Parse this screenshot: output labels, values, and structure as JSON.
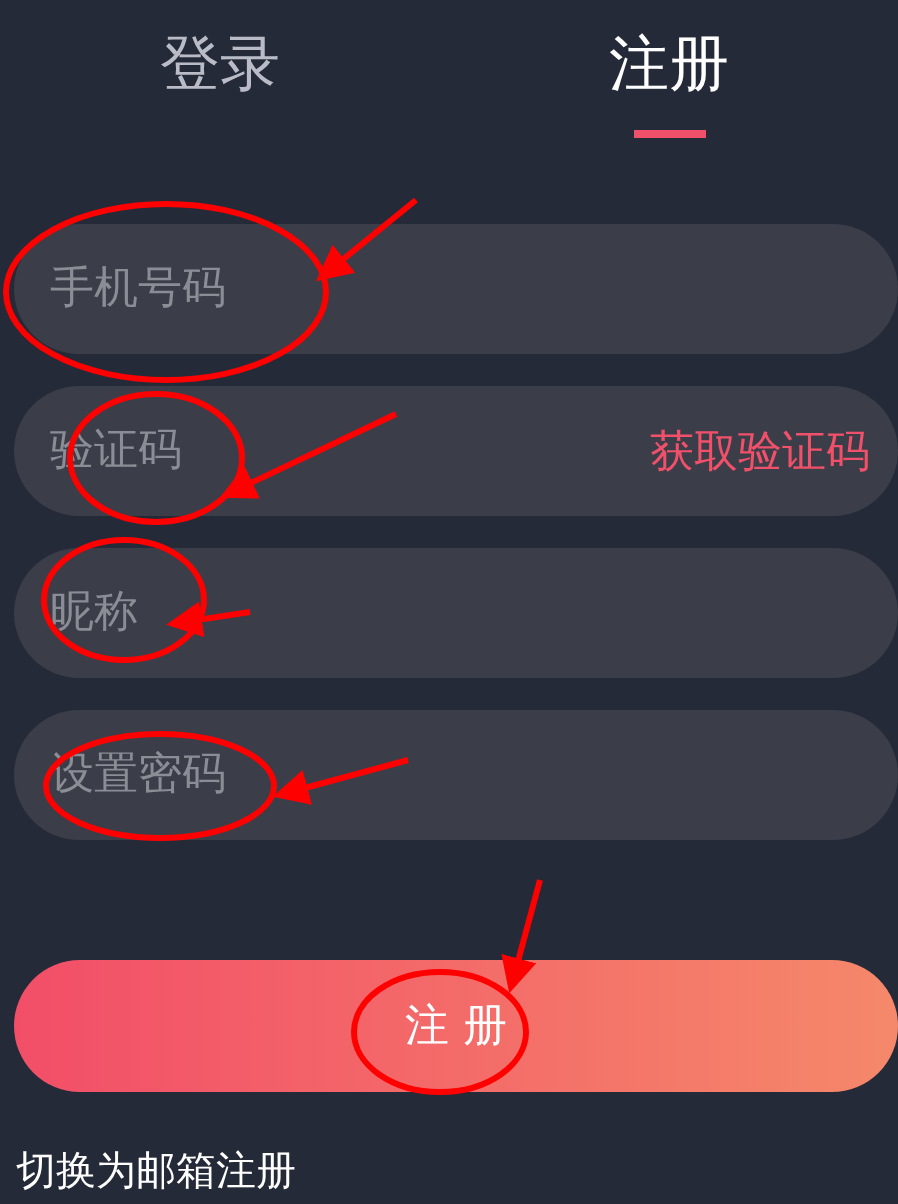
{
  "tabs": [
    {
      "label": "登录",
      "selected": false
    },
    {
      "label": "注册",
      "selected": true
    }
  ],
  "fields": [
    {
      "kind": "text",
      "placeholder": "手机号码"
    },
    {
      "kind": "code",
      "placeholder": "验证码",
      "action": "获取验证码"
    },
    {
      "kind": "text",
      "placeholder": "昵称"
    },
    {
      "kind": "password",
      "placeholder": "设置密码"
    }
  ],
  "submit": "注 册",
  "switch_link": "切换为邮箱注册"
}
